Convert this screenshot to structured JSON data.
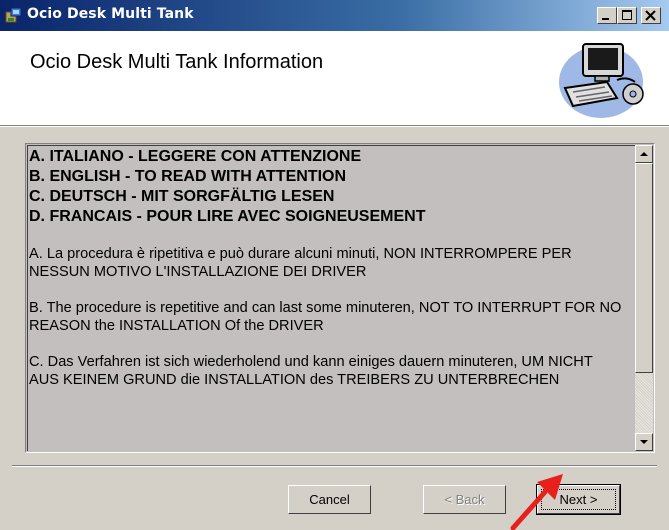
{
  "window": {
    "title": "Ocio Desk Multi Tank",
    "titlebar_colors": [
      "#0a246a",
      "#a6caf0"
    ]
  },
  "header": {
    "title": "Ocio Desk Multi Tank Information",
    "icon": "computer-setup-icon"
  },
  "textbox": {
    "headings": [
      "A.  ITALIANO - LEGGERE CON ATTENZIONE",
      "B.  ENGLISH - TO READ WITH ATTENTION",
      "C.  DEUTSCH - MIT SORGFÄLTIG LESEN",
      "D.  FRANCAIS - POUR LIRE AVEC SOIGNEUSEMENT"
    ],
    "paragraphs": [
      "A. La procedura è ripetitiva e può durare alcuni minuti, NON INTERROMPERE PER NESSUN MOTIVO L'INSTALLAZIONE DEI DRIVER",
      "B. The procedure is repetitive and can last some minuteren, NOT TO INTERRUPT FOR NO REASON the INSTALLATION Of the DRIVER",
      "C. Das Verfahren ist sich wiederholend und kann einiges dauern minuteren, UM NICHT AUS KEINEM GRUND die INSTALLATION des TREIBERS ZU UNTERBRECHEN"
    ]
  },
  "buttons": {
    "cancel": "Cancel",
    "back": "< Back",
    "next": "Next >"
  },
  "annotation": {
    "arrow_color": "#e8201c"
  }
}
